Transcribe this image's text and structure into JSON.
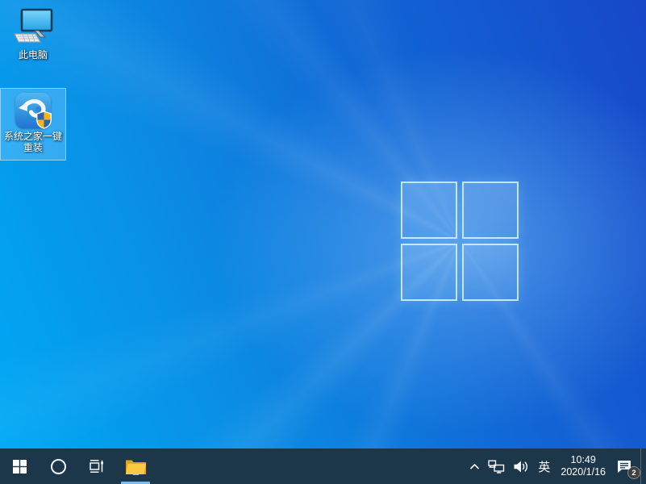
{
  "colors": {
    "taskbar_bg": "#1c3749",
    "wallpaper_bottom_left": "#00a9f5",
    "wallpaper_top_right": "#1747c8",
    "selection_highlight": "#82cdff",
    "explorer_underline": "#79bbee",
    "app_icon_blue_top": "#4db9f0",
    "app_icon_blue_bottom": "#2174d2",
    "shield_gold": "#f6b40e",
    "shield_blue": "#2c63b5",
    "folder_gold": "#fdc944",
    "folder_blue": "#2f9ae0"
  },
  "desktop": {
    "icons": [
      {
        "label": "此电脑",
        "selected": false
      },
      {
        "label_line1": "系统之家一键",
        "label_line2": "重装",
        "selected": true
      }
    ]
  },
  "tray": {
    "ime_label": "英",
    "clock": {
      "time": "10:49",
      "date": "2020/1/16"
    },
    "notification_badge": "2"
  }
}
